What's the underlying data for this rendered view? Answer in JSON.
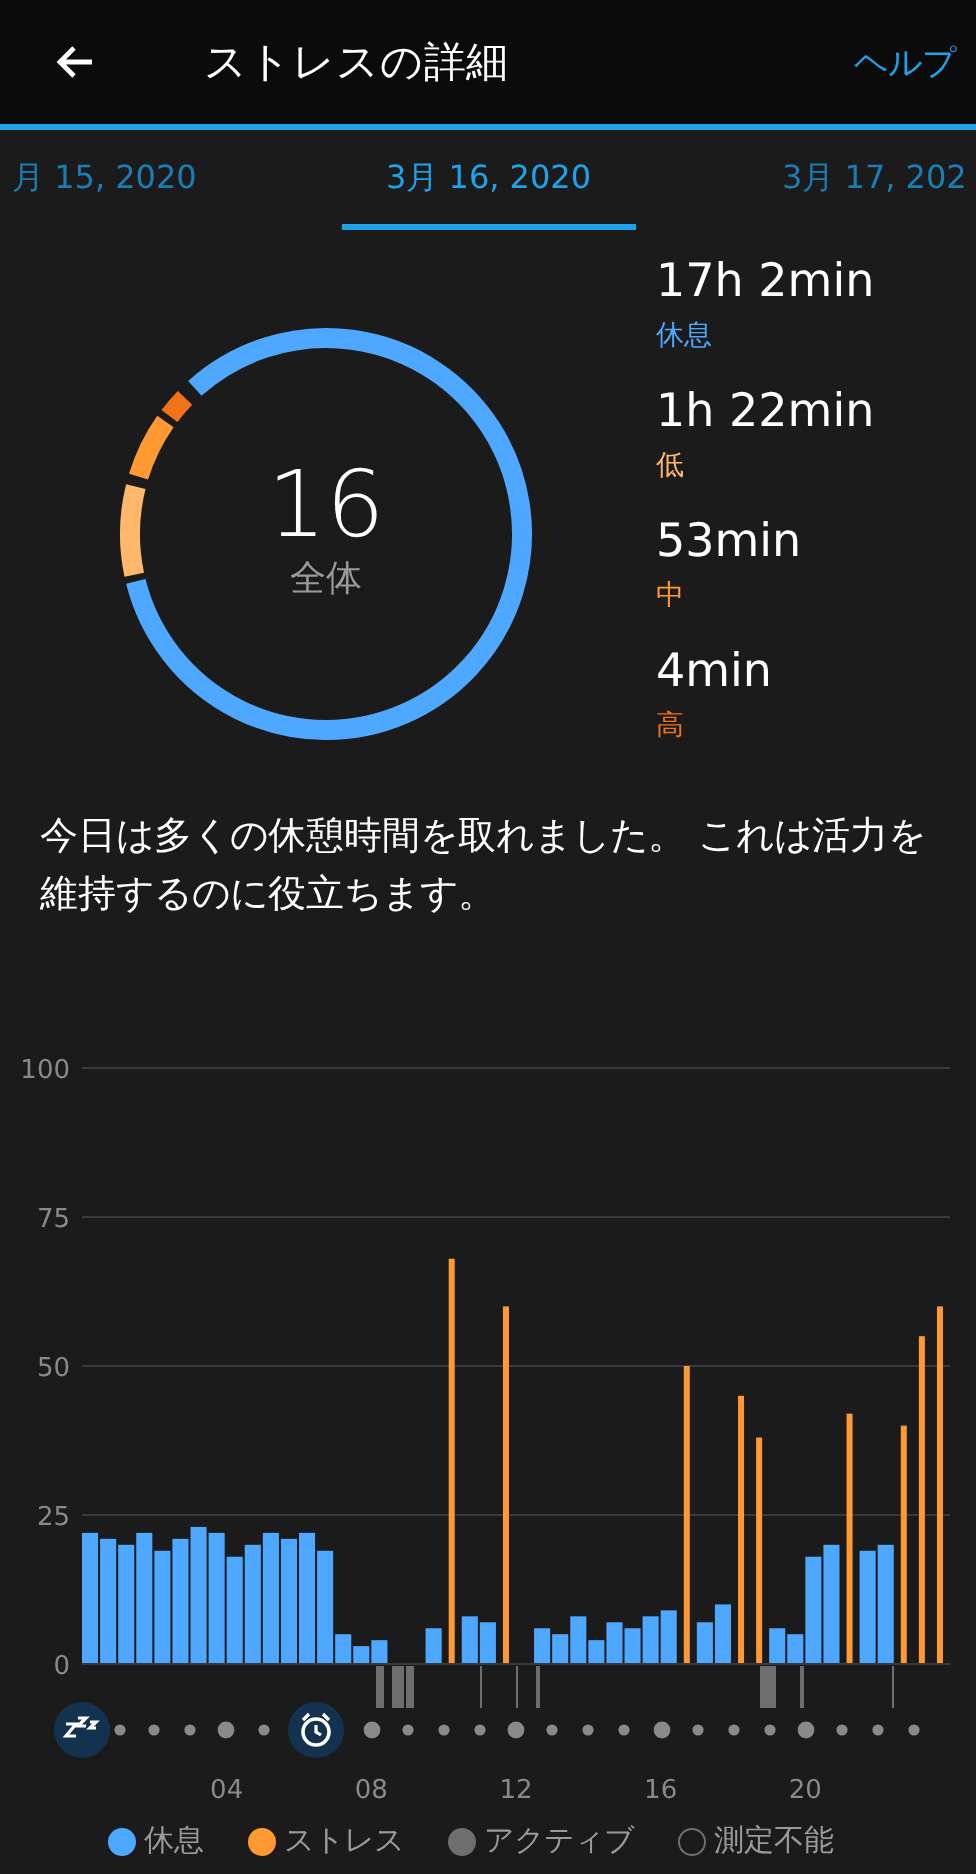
{
  "header": {
    "title": "ストレスの詳細",
    "help": "ヘルプ"
  },
  "tabs": [
    {
      "label": "月 15, 2020",
      "selected": false
    },
    {
      "label": "3月 16, 2020",
      "selected": true
    },
    {
      "label": "3月 17, 202",
      "selected": false
    }
  ],
  "overall": {
    "value": "16",
    "label": "全体"
  },
  "stats": [
    {
      "time": "17h 2min",
      "label": "休息",
      "color": "#4fa8ff"
    },
    {
      "time": "1h 22min",
      "label": "低",
      "color": "#ffb86b"
    },
    {
      "time": "53min",
      "label": "中",
      "color": "#ff9a33"
    },
    {
      "time": "4min",
      "label": "高",
      "color": "#f07318"
    }
  ],
  "message": "今日は多くの休憩時間を取れました。 これは活力を維持するのに役立ちます。",
  "chart": {
    "chart_data": {
      "type": "bar",
      "grid": true,
      "ylim": [
        0,
        100
      ],
      "yticks": [
        {
          "value": 0,
          "label": "0"
        },
        {
          "value": 25,
          "label": "25"
        },
        {
          "value": 50,
          "label": "50"
        },
        {
          "value": 75,
          "label": "75"
        },
        {
          "value": 100,
          "label": "100"
        }
      ],
      "xlim": [
        0,
        24
      ],
      "xticks": [
        {
          "value": 4,
          "label": "04"
        },
        {
          "value": 8,
          "label": "08"
        },
        {
          "value": 12,
          "label": "12"
        },
        {
          "value": 16,
          "label": "16"
        },
        {
          "value": 20,
          "label": "20"
        }
      ],
      "x": [
        0,
        0.5,
        1,
        1.5,
        2,
        2.5,
        3,
        3.5,
        4,
        4.5,
        5,
        5.5,
        6,
        6.5,
        7,
        7.5,
        8,
        8.5,
        9,
        9.5,
        10,
        10.5,
        11,
        11.5,
        12,
        12.5,
        13,
        13.5,
        14,
        14.5,
        15,
        15.5,
        16,
        16.5,
        17,
        17.5,
        18,
        18.5,
        19,
        19.5,
        20,
        20.5,
        21,
        21.5,
        22,
        22.5,
        23,
        23.5
      ],
      "series": [
        {
          "name": "休息",
          "color": "#4fa8ff",
          "values": [
            22,
            21,
            20,
            22,
            19,
            21,
            23,
            22,
            18,
            20,
            22,
            21,
            22,
            19,
            5,
            3,
            4,
            null,
            null,
            6,
            null,
            8,
            7,
            null,
            null,
            6,
            5,
            8,
            4,
            7,
            6,
            8,
            9,
            null,
            7,
            10,
            null,
            null,
            6,
            5,
            18,
            20,
            null,
            19,
            20,
            null,
            null,
            null
          ]
        },
        {
          "name": "ストレス",
          "color": "#ff9a33",
          "values": [
            null,
            null,
            null,
            null,
            null,
            null,
            null,
            null,
            null,
            null,
            null,
            null,
            null,
            null,
            null,
            null,
            null,
            null,
            null,
            null,
            68,
            null,
            null,
            60,
            null,
            null,
            null,
            null,
            null,
            null,
            null,
            null,
            null,
            50,
            null,
            null,
            45,
            38,
            null,
            null,
            null,
            null,
            42,
            null,
            null,
            40,
            55,
            60
          ]
        }
      ]
    }
  },
  "legend": [
    {
      "label": "アクティブ",
      "kind": "filled",
      "color": "#6e6e6e"
    },
    {
      "label": "測定不能",
      "kind": "outline",
      "color": "#6e6e6e"
    }
  ]
}
